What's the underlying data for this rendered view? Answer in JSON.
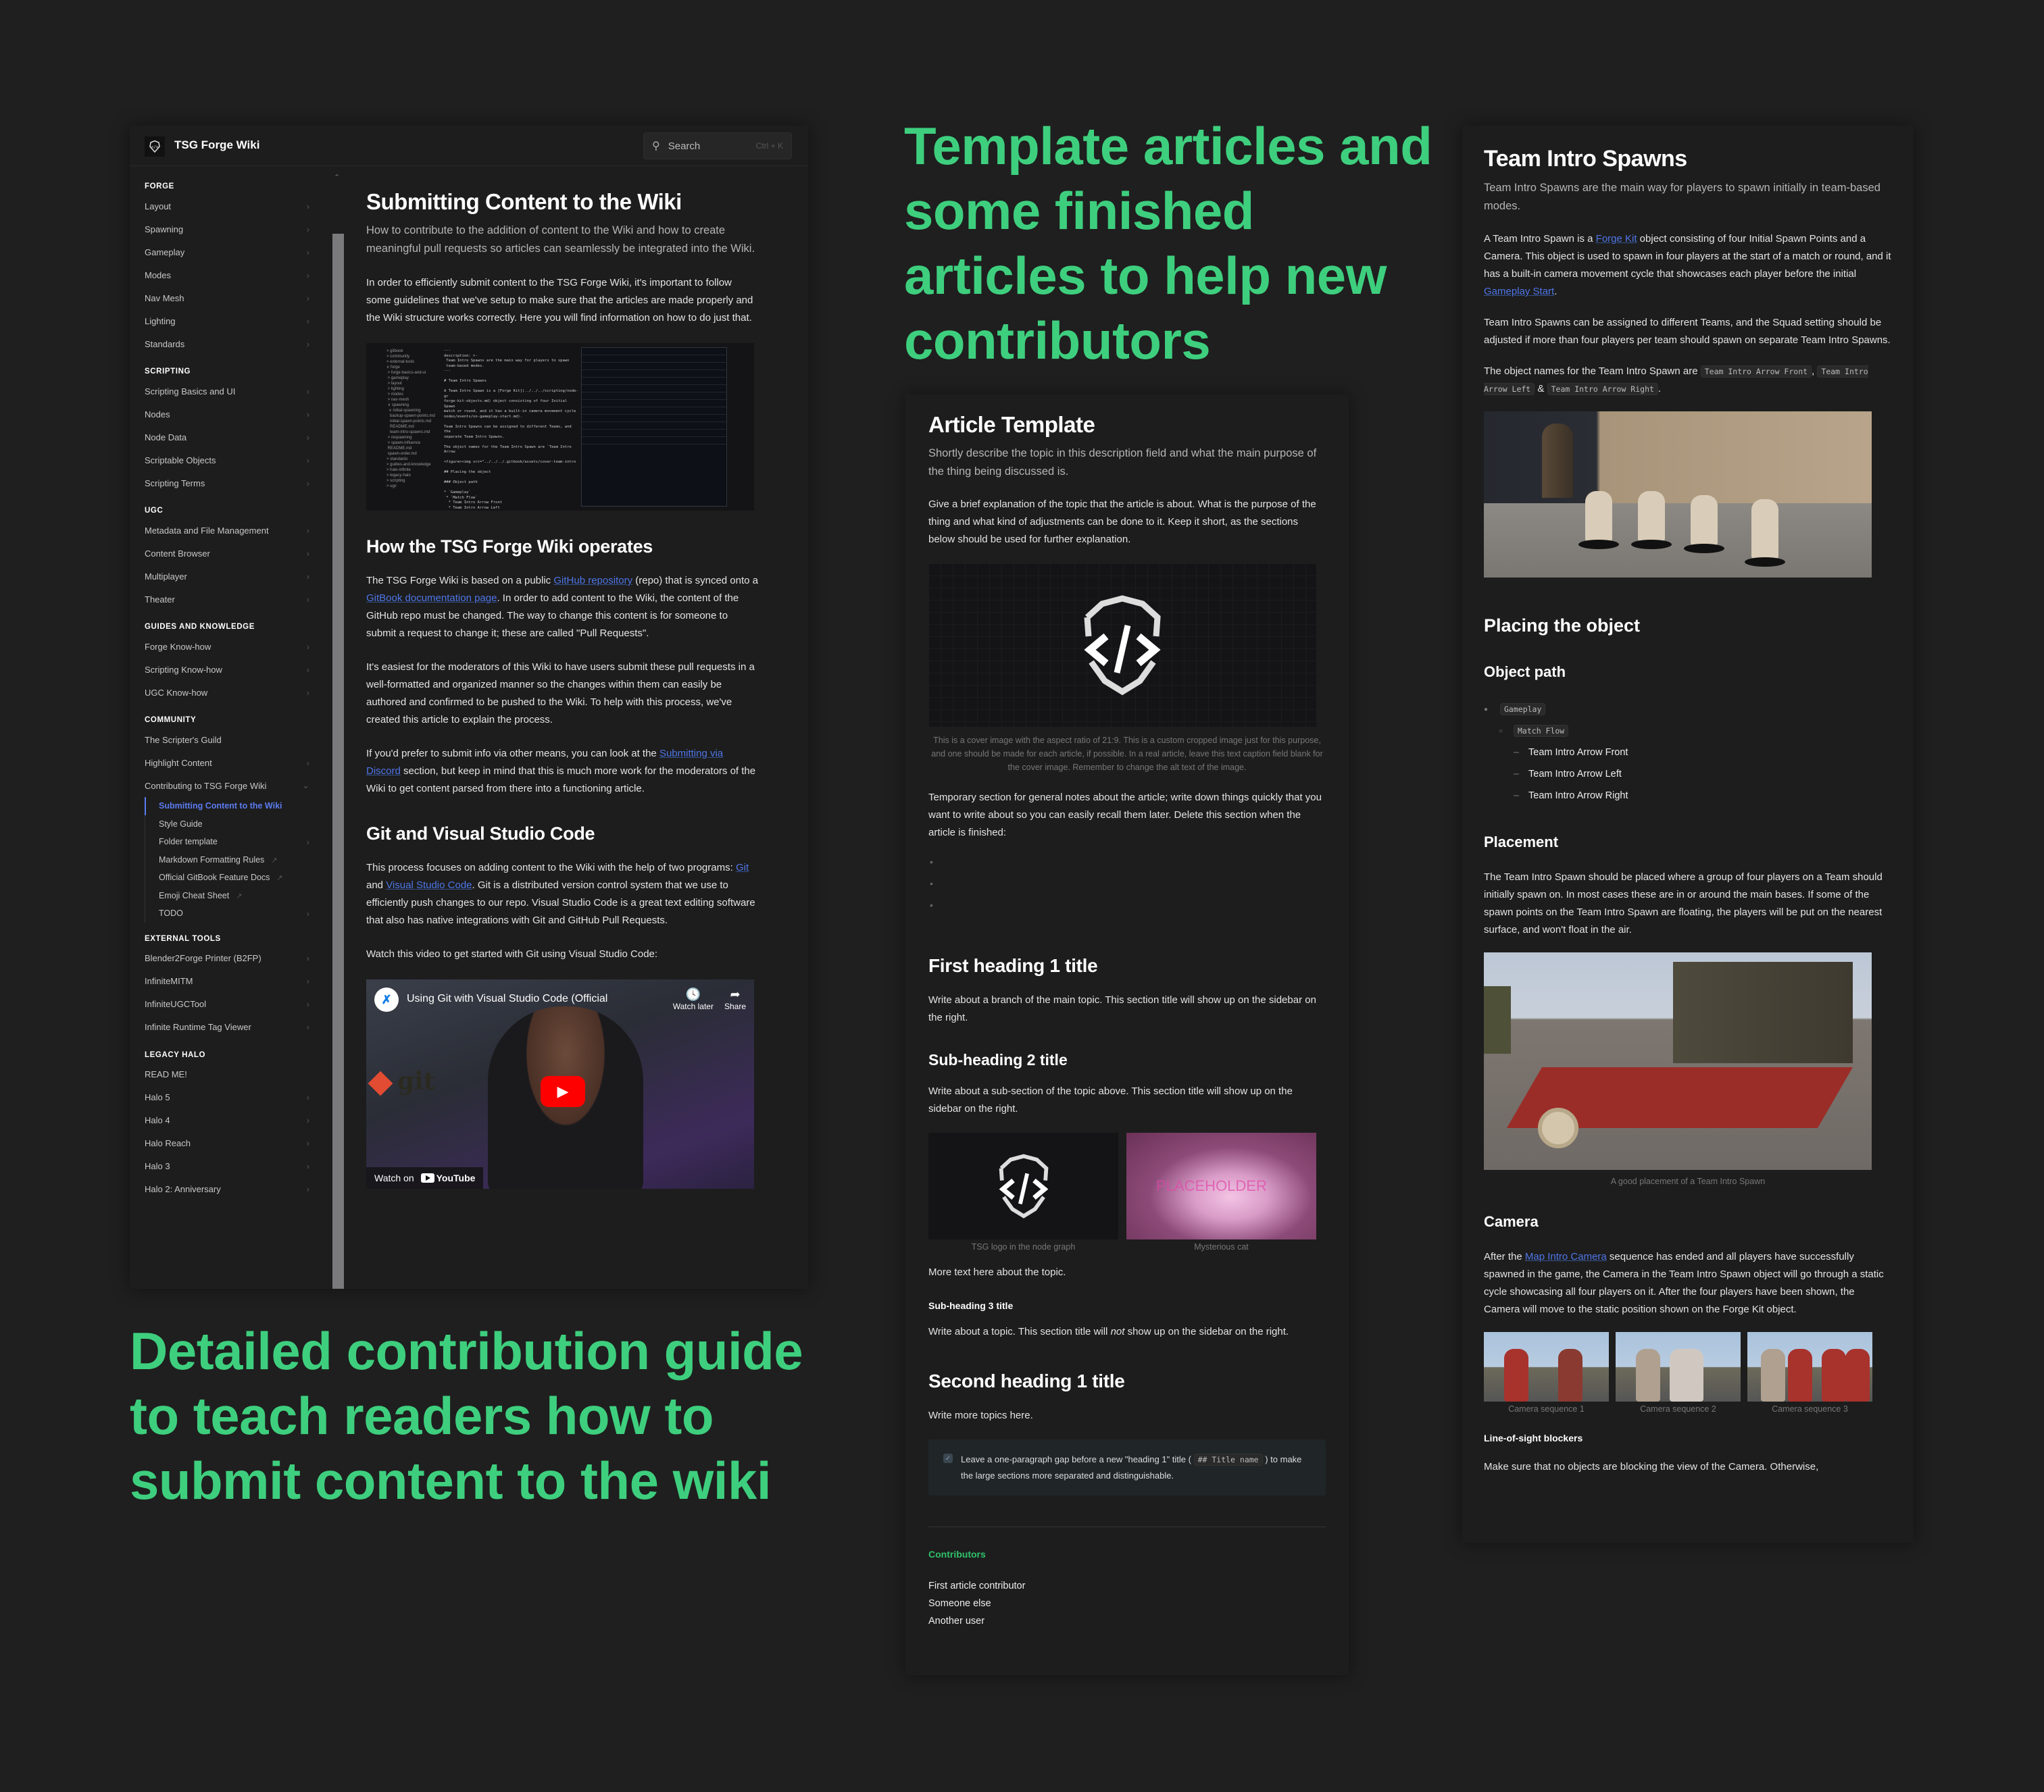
{
  "headlines": {
    "top_right": "Template articles and some finished articles to help new contributors",
    "bottom_left": "Detailed contribution guide to teach readers how to submit content to the wiki"
  },
  "colors": {
    "headline": "#3ecf7e",
    "link": "#4e76e8",
    "active_nav": "#5b7bf0",
    "contributors_heading": "#2fc26a",
    "background": "#1f1f1f"
  },
  "wiki": {
    "site_title": "TSG Forge Wiki",
    "search": {
      "placeholder": "Search",
      "shortcut": "Ctrl + K"
    },
    "sidebar": {
      "sections": [
        {
          "title": "FORGE",
          "items": [
            "Layout",
            "Spawning",
            "Gameplay",
            "Modes",
            "Nav Mesh",
            "Lighting",
            "Standards"
          ]
        },
        {
          "title": "SCRIPTING",
          "items": [
            "Scripting Basics and UI",
            "Nodes",
            "Node Data",
            "Scriptable Objects",
            "Scripting Terms"
          ]
        },
        {
          "title": "UGC",
          "items": [
            "Metadata and File Management",
            "Content Browser",
            "Multiplayer",
            "Theater"
          ]
        },
        {
          "title": "GUIDES AND KNOWLEDGE",
          "items": [
            "Forge Know-how",
            "Scripting Know-how",
            "UGC Know-how"
          ]
        },
        {
          "title": "COMMUNITY",
          "items": [
            "The Scripter's Guild",
            "Highlight Content",
            "Contributing to TSG Forge Wiki"
          ]
        },
        {
          "title": "EXTERNAL TOOLS",
          "items": [
            "Blender2Forge Printer (B2FP)",
            "InfiniteMITM",
            "InfiniteUGCTool",
            "Infinite Runtime Tag Viewer"
          ]
        },
        {
          "title": "LEGACY HALO",
          "items": [
            "READ ME!",
            "Halo 5",
            "Halo 4",
            "Halo Reach",
            "Halo 3",
            "Halo 2: Anniversary"
          ]
        }
      ],
      "contributing_children": [
        "Submitting Content to the Wiki",
        "Style Guide",
        "Folder template",
        "Markdown Formatting Rules",
        "Official GitBook Feature Docs",
        "Emoji Cheat Sheet",
        "TODO"
      ]
    },
    "article": {
      "title": "Submitting Content to the Wiki",
      "description": "How to contribute to the addition of content to the Wiki and how to create meaningful pull requests so articles can seamlessly be integrated into the Wiki.",
      "intro": "In order to efficiently submit content to the TSG Forge Wiki, it's important to follow some guidelines that we've setup to make sure that the articles are made properly and the Wiki structure works correctly. Here you will find information on how to do just that.",
      "h2_operates": "How the TSG Forge Wiki operates",
      "op_p1": {
        "a": "The TSG Forge Wiki is based on a public ",
        "link1": "GitHub repository",
        "b": " (repo) that is synced onto a ",
        "link2": "GitBook documentation page",
        "c": ". In order to add content to the Wiki, the content of the GitHub repo must be changed. The way to change this content is for someone to submit a request to change it; these are called \"Pull Requests\"."
      },
      "op_p2": "It's easiest for the moderators of this Wiki to have users submit these pull requests in a well-formatted and organized manner so the changes within them can easily be authored and confirmed to be pushed to the Wiki. To help with this process, we've created this article to explain the process.",
      "op_p3": {
        "a": "If you'd prefer to submit info via other means, you can look at the ",
        "link": "Submitting via Discord",
        "b": " section, but keep in mind that this is much more work for the moderators of the Wiki to get content parsed from there into a functioning article."
      },
      "h2_git": "Git and Visual Studio Code",
      "git_p1": {
        "a": "This process focuses on adding content to the Wiki with the help of two programs: ",
        "link1": "Git",
        "b": " and ",
        "link2": "Visual Studio Code",
        "c": ". Git is a distributed version control system that we use to efficiently push changes to our repo. Visual Studio Code is a great text editing software that also has native integrations with Git and GitHub Pull Requests."
      },
      "git_p2": "Watch this video to get started with Git using Visual Studio Code:",
      "video": {
        "title": "Using Git with Visual Studio Code (Official",
        "watch_later": "Watch later",
        "share": "Share",
        "watch_on": "Watch on",
        "youtube": "YouTube",
        "git_logo": "git"
      }
    }
  },
  "template": {
    "title": "Article Template",
    "description": "Shortly describe the topic in this description field and what the main purpose of the thing being discussed is.",
    "intro": "Give a brief explanation of the topic that the article is about. What is the purpose of the thing and what kind of adjustments can be done to it. Keep it short, as the sections below should be used for further explanation.",
    "cover_caption": "This is a cover image with the aspect ratio of 21:9. This is a custom cropped image just for this purpose, and one should be made for each article, if possible. In a real article, leave this text caption field blank for the cover image. Remember to change the alt text of the image.",
    "temp_notes": "Temporary section for general notes about the article; write down things quickly that you want to write about so you can easily recall them later. Delete this section when the article is finished:",
    "h1_first": "First heading 1 title",
    "p_first": "Write about a branch of the main topic. This section title will show up on the sidebar on the right.",
    "h2_sub": "Sub-heading 2 title",
    "p_sub": "Write about a sub-section of the topic above. This section title will show up on the sidebar on the right.",
    "img_caption_1": "TSG logo in the node graph",
    "img_caption_2": "Mysterious cat",
    "placeholder_watermark": "PLACEHOLDER",
    "p_more": "More text here about the topic.",
    "h3_sub": "Sub-heading 3 title",
    "p_h3": {
      "a": "Write about a topic. This section title will ",
      "em": "not",
      "b": " show up on the sidebar on the right."
    },
    "h1_second": "Second heading 1 title",
    "p_second": "Write more topics here.",
    "hint": {
      "a": "Leave a one-paragraph gap before a new \"heading 1\" title ( ",
      "code": "## Title name",
      "b": " ) to make the large sections more separated and distinguishable."
    },
    "contributors_title": "Contributors",
    "contributors": [
      "First article contributor",
      "Someone else",
      "Another user"
    ]
  },
  "finished": {
    "title": "Team Intro Spawns",
    "description": "Team Intro Spawns are the main way for players to spawn initially in team-based modes.",
    "p1": {
      "a": "A Team Intro Spawn is a ",
      "link1": "Forge Kit",
      "b": " object consisting of four Initial Spawn Points and a Camera. This object is used to spawn in four players at the start of a match or round, and it has a built-in camera movement cycle that showcases each player before the initial ",
      "link2": "Gameplay Start",
      "c": "."
    },
    "p2": "Team Intro Spawns can be assigned to different Teams, and the Squad setting should be adjusted if more than four players per team should spawn on separate Team Intro Spawns.",
    "p3": {
      "a": "The object names for the Team Intro Spawn are ",
      "code1": "Team Intro Arrow Front",
      "b": ", ",
      "code2": "Team Intro Arrow Left",
      "c": " & ",
      "code3": "Team Intro Arrow Right",
      "d": "."
    },
    "h2_placing": "Placing the object",
    "h3_path": "Object path",
    "path": {
      "level1": "Gameplay",
      "level2": "Match Flow",
      "items": [
        "Team Intro Arrow Front",
        "Team Intro Arrow Left",
        "Team Intro Arrow Right"
      ]
    },
    "h3_placement": "Placement",
    "p_placement": "The Team Intro Spawn should be placed where a group of four players on a Team should initially spawn on. In most cases these are in or around the main bases. If some of the spawn points on the Team Intro Spawn are floating, the players will be put on the nearest surface, and won't float in the air.",
    "placement_caption": "A good placement of a Team Intro Spawn",
    "h3_camera": "Camera",
    "p_camera": {
      "a": "After the ",
      "link": "Map Intro Camera",
      "b": " sequence has ended and all players have successfully spawned in the game, the Camera in the Team Intro Spawn object will go through a static cycle showcasing all four players on it. After the four players have been shown, the Camera will move to the static position shown on the Forge Kit object."
    },
    "camera_captions": [
      "Camera sequence 1",
      "Camera sequence 2",
      "Camera sequence 3"
    ],
    "h4_los": "Line-of-sight blockers",
    "p_los": "Make sure that no objects are blocking the view of the Camera. Otherwise,"
  }
}
